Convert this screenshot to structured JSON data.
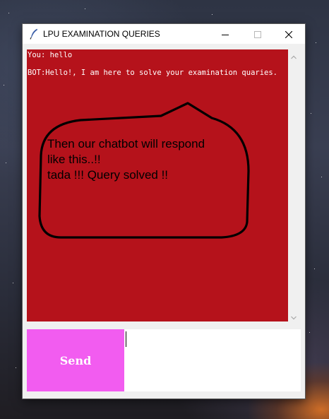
{
  "window": {
    "title": "LPU EXAMINATION QUERIES",
    "app_icon": "feather-icon",
    "controls": [
      "minimize-icon",
      "maximize-icon",
      "close-icon"
    ]
  },
  "chat": {
    "background_color": "#b5121b",
    "messages": [
      {
        "sender": "user",
        "text": "You: hello"
      },
      {
        "sender": "bot",
        "text": "BOT:Hello!, I am here to solve your examination quaries."
      }
    ],
    "callout": {
      "text": "Then our chatbot will respond\nlike this..!!\ntada !!! Query solved !!"
    }
  },
  "send": {
    "label": "Send",
    "color": "#f25cf0"
  },
  "input": {
    "value": ""
  }
}
